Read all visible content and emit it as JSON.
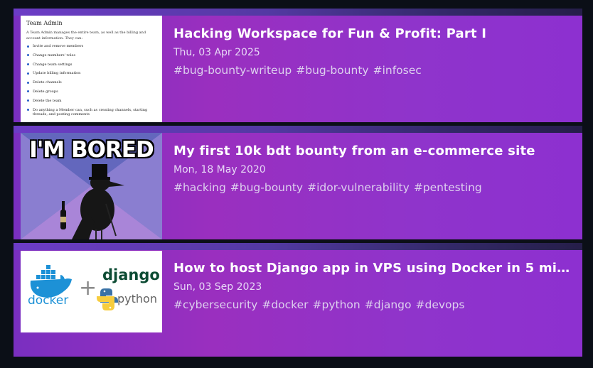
{
  "posts": [
    {
      "title": "Hacking Workspace for Fun & Profit: Part I",
      "date": "Thu, 03 Apr 2025",
      "tags": [
        "#bug-bounty-writeup",
        "#bug-bounty",
        "#infosec"
      ],
      "thumbnail": {
        "kind": "document-screenshot",
        "heading": "Team Admin",
        "description": "A Team Admin manages the entire team, as well as the billing and account information. They can:",
        "items": [
          "Invite and remove members",
          "Change members' roles",
          "Change team settings",
          "Update billing information",
          "Delete channels",
          "Delete groups",
          "Delete the team",
          "Do anything a Member can, such as creating channels, starting threads, and posting comments"
        ]
      }
    },
    {
      "title": "My first 10k bdt bounty from an e-commerce site",
      "date": "Mon, 18 May 2020",
      "tags": [
        "#hacking",
        "#bug-bounty",
        "#idor-vulnerability",
        "#pentesting"
      ],
      "thumbnail": {
        "kind": "meme",
        "caption": "I'M BORED"
      }
    },
    {
      "title": "How to host Django app in VPS using Docker in 5 mi...",
      "date": "Sun, 03 Sep 2023",
      "tags": [
        "#cybersecurity",
        "#docker",
        "#python",
        "#django",
        "#devops"
      ],
      "thumbnail": {
        "kind": "logos",
        "left_logo": "docker",
        "plus": "+",
        "right_logo_top": "django",
        "right_logo_bottom": "python"
      }
    }
  ],
  "colors": {
    "page_background": "#0b0f17",
    "card_gradient_start": "#7a2fc0",
    "card_gradient_end": "#8d30d0",
    "title": "#ffffff",
    "meta_text": "#e7d8f6",
    "docker_blue": "#1d91d6",
    "django_green": "#0c4b33"
  }
}
